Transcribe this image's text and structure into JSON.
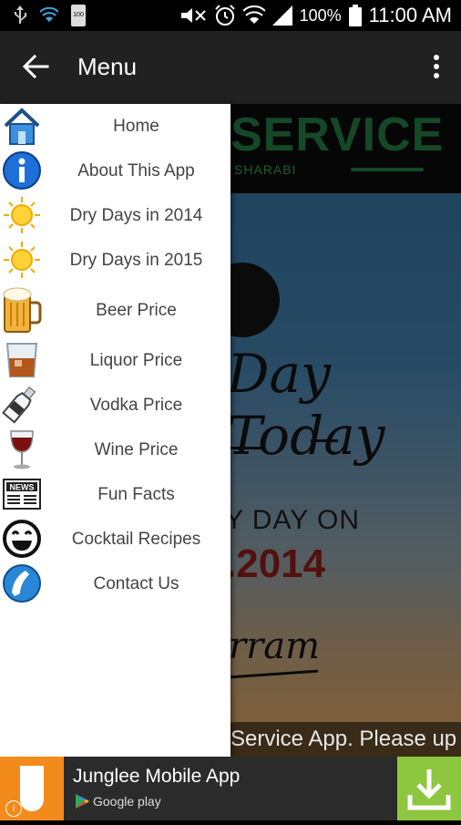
{
  "statusbar": {
    "battery_small": "100",
    "battery_percent": "100%",
    "time": "11:00 AM"
  },
  "appbar": {
    "title": "Menu"
  },
  "drawer": {
    "items": [
      {
        "label": "Home",
        "icon": "home-icon"
      },
      {
        "label": "About This App",
        "icon": "info-icon"
      },
      {
        "label": "Dry Days in 2014",
        "icon": "sun-icon"
      },
      {
        "label": "Dry Days in 2015",
        "icon": "sun-icon"
      },
      {
        "label": "Beer Price",
        "icon": "beer-mug-icon"
      },
      {
        "label": "Liquor Price",
        "icon": "whiskey-glass-icon"
      },
      {
        "label": "Vodka Price",
        "icon": "vodka-bottle-icon"
      },
      {
        "label": "Wine Price",
        "icon": "wine-glass-icon"
      },
      {
        "label": "Fun Facts",
        "icon": "news-icon"
      },
      {
        "label": "Cocktail Recipes",
        "icon": "smiley-icon"
      },
      {
        "label": "Contact Us",
        "icon": "phone-icon"
      }
    ]
  },
  "background": {
    "service": "SERVICE",
    "sharabi": "SHARABI",
    "day_today": "Day Today",
    "dry_day_on": "Y DAY ON",
    "date": ".2014",
    "rram": "rram",
    "marquee": "Service App. Please up"
  },
  "ad": {
    "title": "Junglee Mobile App",
    "store": "Google play",
    "info": "i"
  },
  "colors": {
    "appbar": "#212121",
    "ad_logo": "#f38b1c",
    "download": "#8dc63f"
  }
}
